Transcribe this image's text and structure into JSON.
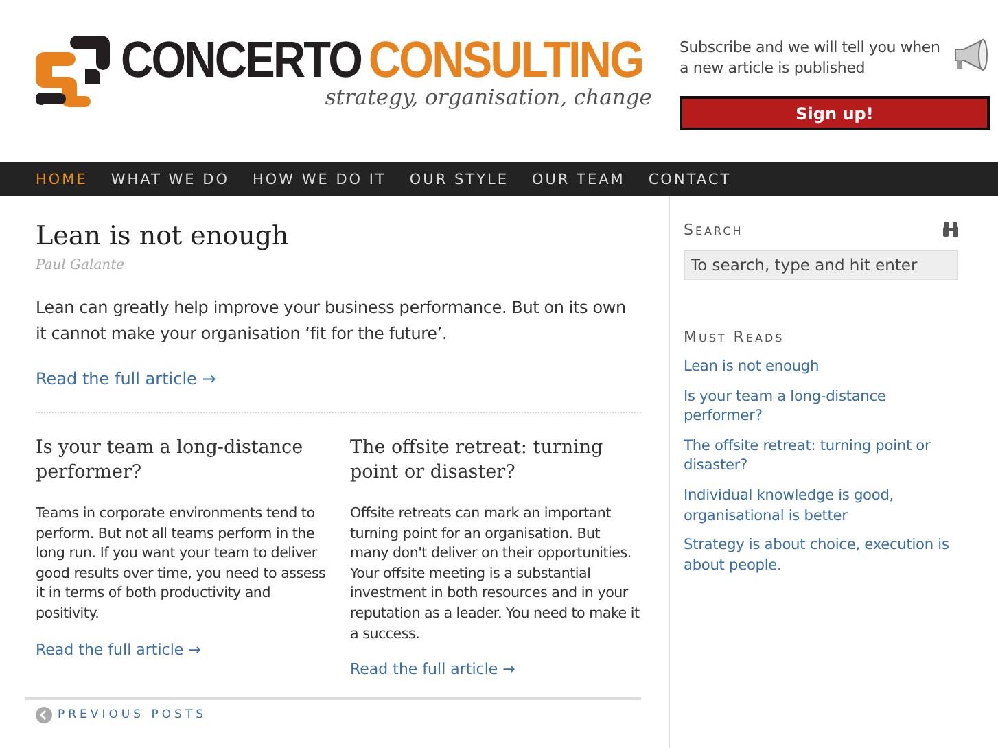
{
  "header": {
    "logo": {
      "word_1": "CONCERTO",
      "word_2": "CONSULTING",
      "tagline": "strategy, organisation, change"
    },
    "subscribe": {
      "text": "Subscribe and we will tell you when a new article is published",
      "button": "Sign up!"
    }
  },
  "nav": [
    {
      "label": "HOME",
      "selected": true
    },
    {
      "label": "WHAT WE DO",
      "selected": false
    },
    {
      "label": "HOW WE DO IT",
      "selected": false
    },
    {
      "label": "OUR STYLE",
      "selected": false
    },
    {
      "label": "OUR TEAM",
      "selected": false
    },
    {
      "label": "CONTACT",
      "selected": false
    }
  ],
  "featured": {
    "title": "Lean is not enough",
    "author": "Paul Galante",
    "excerpt": "Lean can greatly help improve your business performance. But on its own it cannot make your organisation ‘fit for the future’.",
    "link": "Read the full article →"
  },
  "posts": [
    {
      "title": "Is your team a long-distance performer?",
      "excerpt": "Teams in corporate environments tend to perform. But not all teams perform in the long run. If you want your team to deliver good results over time, you need to assess it in terms of both productivity and positivity.",
      "link": "Read the full article →"
    },
    {
      "title": "The offsite retreat: turning point or disaster?",
      "excerpt": "Offsite retreats can mark an important turning point for an organisation. But many don't deliver on their opportunities. Your offsite meeting is a substantial investment in both resources and in your reputation as a leader. You need to make it a success.",
      "link": "Read the full article →"
    }
  ],
  "pagination": {
    "previous": "PREVIOUS POSTS"
  },
  "sidebar": {
    "search": {
      "heading": "Search",
      "placeholder": "To search, type and hit enter"
    },
    "must_reads": {
      "heading": "Must Reads",
      "items": [
        "Lean is not enough",
        "Is your team a long-distance performer?",
        "The offsite retreat: turning point or disaster?",
        "Individual knowledge is good, organisational is better",
        "Strategy is about choice, execution is about people."
      ]
    }
  }
}
